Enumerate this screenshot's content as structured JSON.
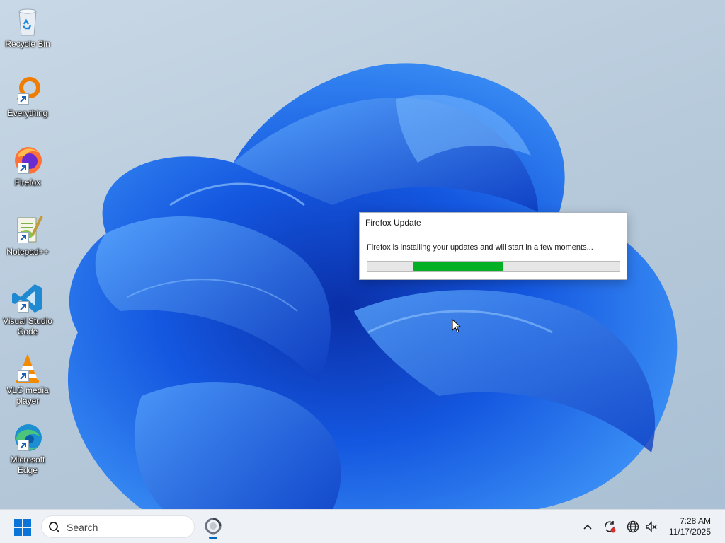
{
  "desktop": {
    "icons": [
      {
        "label": "Recycle Bin",
        "icon": "recycle-bin-icon",
        "shortcut": false
      },
      {
        "label": "Everything",
        "icon": "everything-search-icon",
        "shortcut": true
      },
      {
        "label": "Firefox",
        "icon": "firefox-icon",
        "shortcut": true
      },
      {
        "label": "Notepad++",
        "icon": "notepad-plus-plus-icon",
        "shortcut": true
      },
      {
        "label": "Visual Studio Code",
        "icon": "vscode-icon",
        "shortcut": true
      },
      {
        "label": "VLC media player",
        "icon": "vlc-icon",
        "shortcut": true
      },
      {
        "label": "Microsoft Edge",
        "icon": "edge-icon",
        "shortcut": true
      }
    ]
  },
  "dialog": {
    "title": "Firefox Update",
    "message": "Firefox is installing your updates and will start in a few moments..."
  },
  "taskbar": {
    "search_placeholder": "Search",
    "clock_time": "7:28 AM",
    "clock_date": "11/17/2025",
    "tray_icons": [
      "chevron-up-icon",
      "update-sync-icon",
      "network-globe-icon",
      "volume-muted-icon"
    ]
  },
  "colors": {
    "progress_fill": "#06b025",
    "wallpaper_blue": "#1a5fe0",
    "taskbar_bg": "#eef2f7",
    "accent": "#0067c0"
  }
}
